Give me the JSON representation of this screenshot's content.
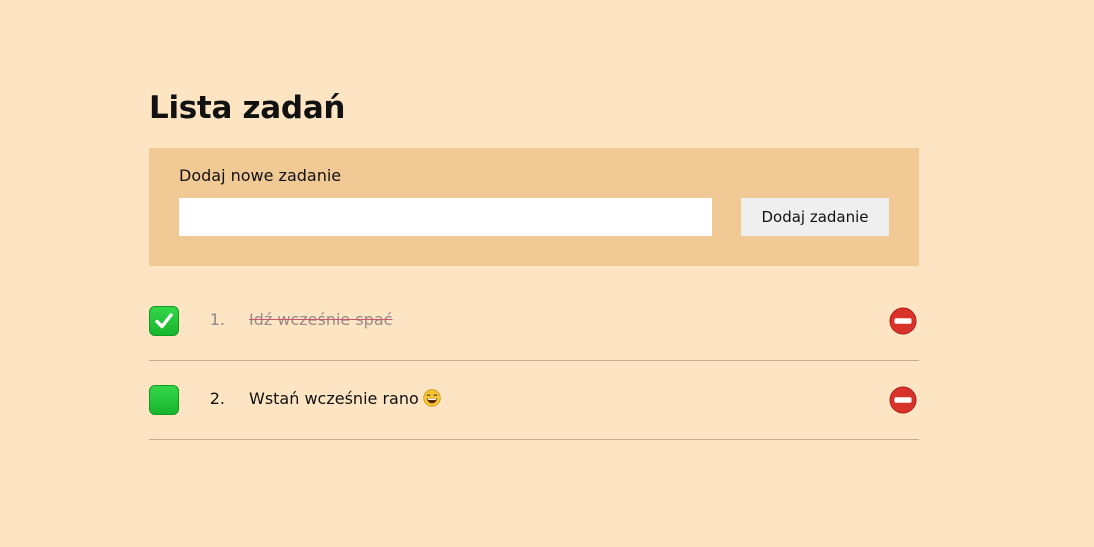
{
  "app": {
    "title": "Lista zadań"
  },
  "form": {
    "label": "Dodaj nowe zadanie",
    "input_value": "",
    "input_placeholder": "",
    "button_label": "Dodaj zadanie"
  },
  "tasks": [
    {
      "number": "1.",
      "text": "Idź wcześnie spać",
      "done": true,
      "icon": "checkmark-icon"
    },
    {
      "number": "2.",
      "text": "Wstań wcześnie rano",
      "done": false,
      "emoji": "laughing-face-icon"
    }
  ],
  "icons": {
    "delete": "no-entry-icon",
    "checkbox": "checkbox-icon"
  },
  "colors": {
    "background": "#fde4c2",
    "panel": "#f1c995",
    "checkbox": "#1fbf33",
    "delete": "#d8322b"
  }
}
